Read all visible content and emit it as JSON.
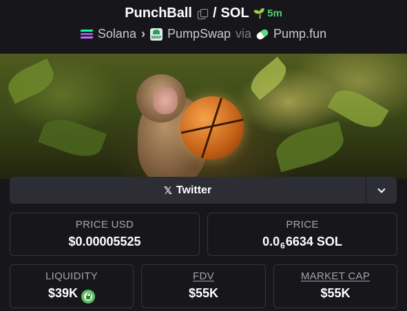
{
  "header": {
    "token": "PunchBall",
    "separator": "/",
    "quote": "SOL",
    "age": "5m",
    "chain": "Solana",
    "dex": "PumpSwap",
    "via": "via",
    "launchpad": "Pump.fun",
    "icons": [
      "copy-icon",
      "sprout-icon",
      "solana-icon",
      "pumpswap-icon",
      "pill-icon"
    ]
  },
  "social": {
    "twitter_label": "Twitter",
    "icons": [
      "x-icon",
      "chevron-down-icon"
    ]
  },
  "stats": {
    "price_usd_label": "PRICE USD",
    "price_usd_value": "$0.00005525",
    "price_label": "PRICE",
    "price_value_prefix": "0.0",
    "price_value_subscript": "6",
    "price_value_suffix": "6634 SOL",
    "liquidity_label": "LIQUIDITY",
    "liquidity_value": "$39K",
    "fdv_label": "FDV",
    "fdv_value": "$55K",
    "mcap_label": "MARKET CAP",
    "mcap_value": "$55K"
  },
  "colors": {
    "background": "#17171b",
    "accent_green": "#4fd16c",
    "card_border": "#34353c",
    "button_bg": "#2d2e35"
  }
}
